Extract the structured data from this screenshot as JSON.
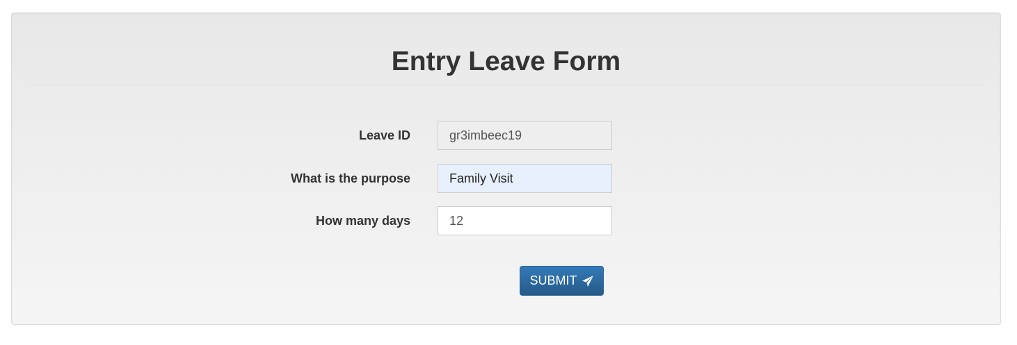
{
  "form": {
    "title": "Entry Leave Form",
    "fields": {
      "leave_id": {
        "label": "Leave ID",
        "value": "gr3imbeec19"
      },
      "purpose": {
        "label": "What is the purpose",
        "value": "Family Visit"
      },
      "days": {
        "label": "How many days",
        "value": "12"
      }
    },
    "submit": {
      "label": "SUBMIT",
      "icon": "paper-plane-icon"
    }
  },
  "colors": {
    "button_primary": "#337ab7",
    "autofill_bg": "#e8f0fe",
    "readonly_bg": "#eeeeee"
  }
}
